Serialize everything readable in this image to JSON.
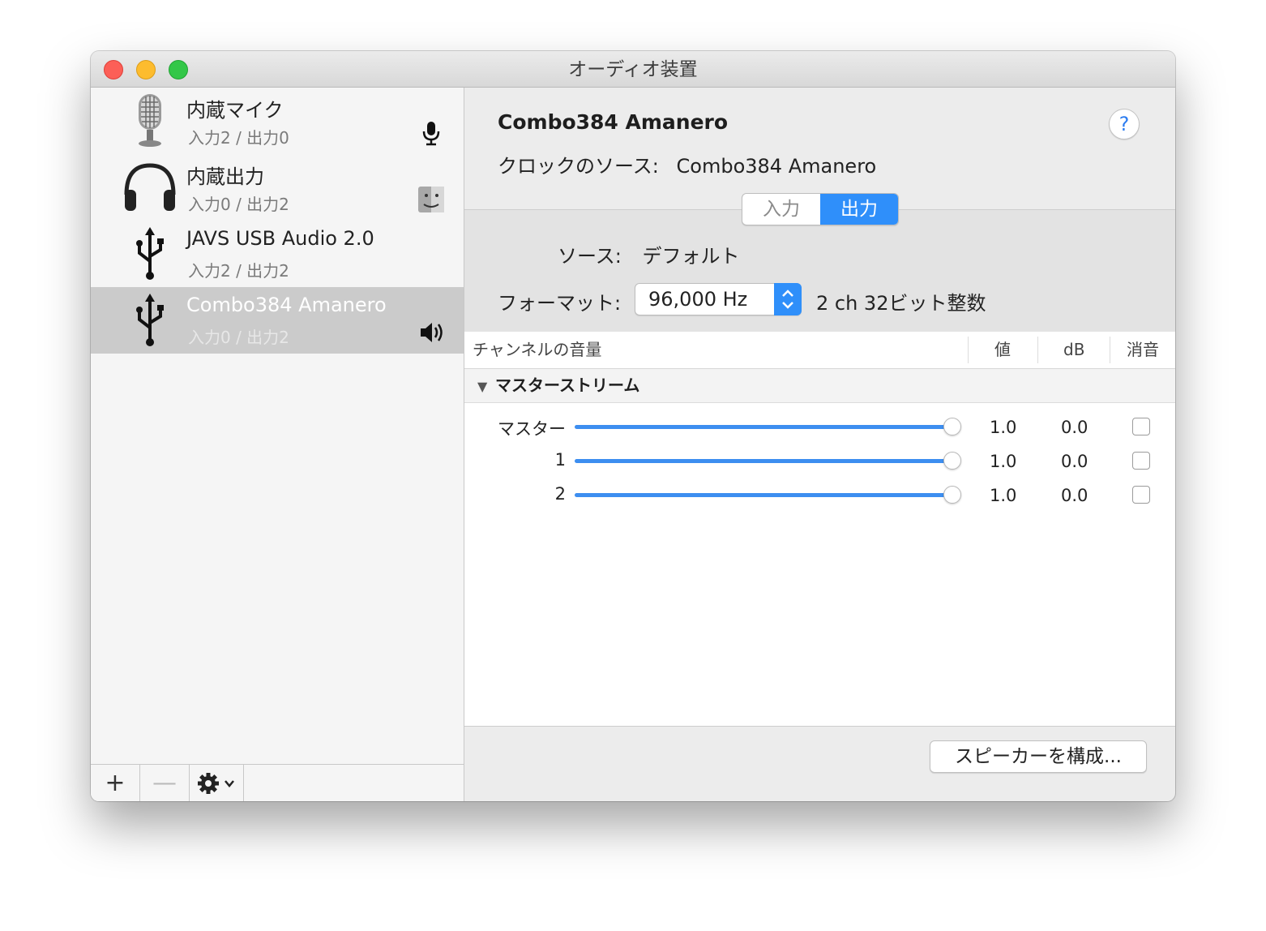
{
  "window": {
    "title": "オーディオ装置"
  },
  "sidebar": {
    "devices": [
      {
        "name": "内蔵マイク",
        "io": "入力2 / 出力0",
        "icon": "microphone-icon",
        "badge": "mic-badge-icon"
      },
      {
        "name": "内蔵出力",
        "io": "入力0 / 出力2",
        "icon": "headphones-icon",
        "badge": "finder-badge-icon"
      },
      {
        "name": "JAVS USB Audio 2.0",
        "io": "入力2 / 出力2",
        "icon": "usb-icon"
      },
      {
        "name": "Combo384 Amanero",
        "io": "入力0 / 出力2",
        "icon": "usb-icon",
        "badge": "speaker-badge-icon",
        "selected": true
      }
    ],
    "add_label": "+",
    "remove_label": "—"
  },
  "detail": {
    "device_title": "Combo384 Amanero",
    "help_label": "?",
    "clock_label": "クロックのソース:",
    "clock_value": "Combo384 Amanero",
    "tabs": [
      {
        "label": "入力"
      },
      {
        "label": "出力",
        "active": true
      }
    ],
    "source_label": "ソース:",
    "source_value": "デフォルト",
    "format_label": "フォーマット:",
    "format_value": "96,000 Hz",
    "format_desc": "2 ch 32ビット整数",
    "table": {
      "headers": {
        "channel": "チャンネルの音量",
        "value": "値",
        "db": "dB",
        "mute": "消音"
      },
      "group": "マスターストリーム",
      "rows": [
        {
          "label": "マスター",
          "level": 1.0,
          "value": "1.0",
          "db": "0.0",
          "muted": false
        },
        {
          "label": "1",
          "level": 1.0,
          "value": "1.0",
          "db": "0.0",
          "muted": false
        },
        {
          "label": "2",
          "level": 1.0,
          "value": "1.0",
          "db": "0.0",
          "muted": false
        }
      ]
    },
    "configure_label": "スピーカーを構成..."
  },
  "colors": {
    "accent": "#2f8ffa",
    "slider": "#3d8ef0",
    "selection": "#cbcbcb"
  }
}
